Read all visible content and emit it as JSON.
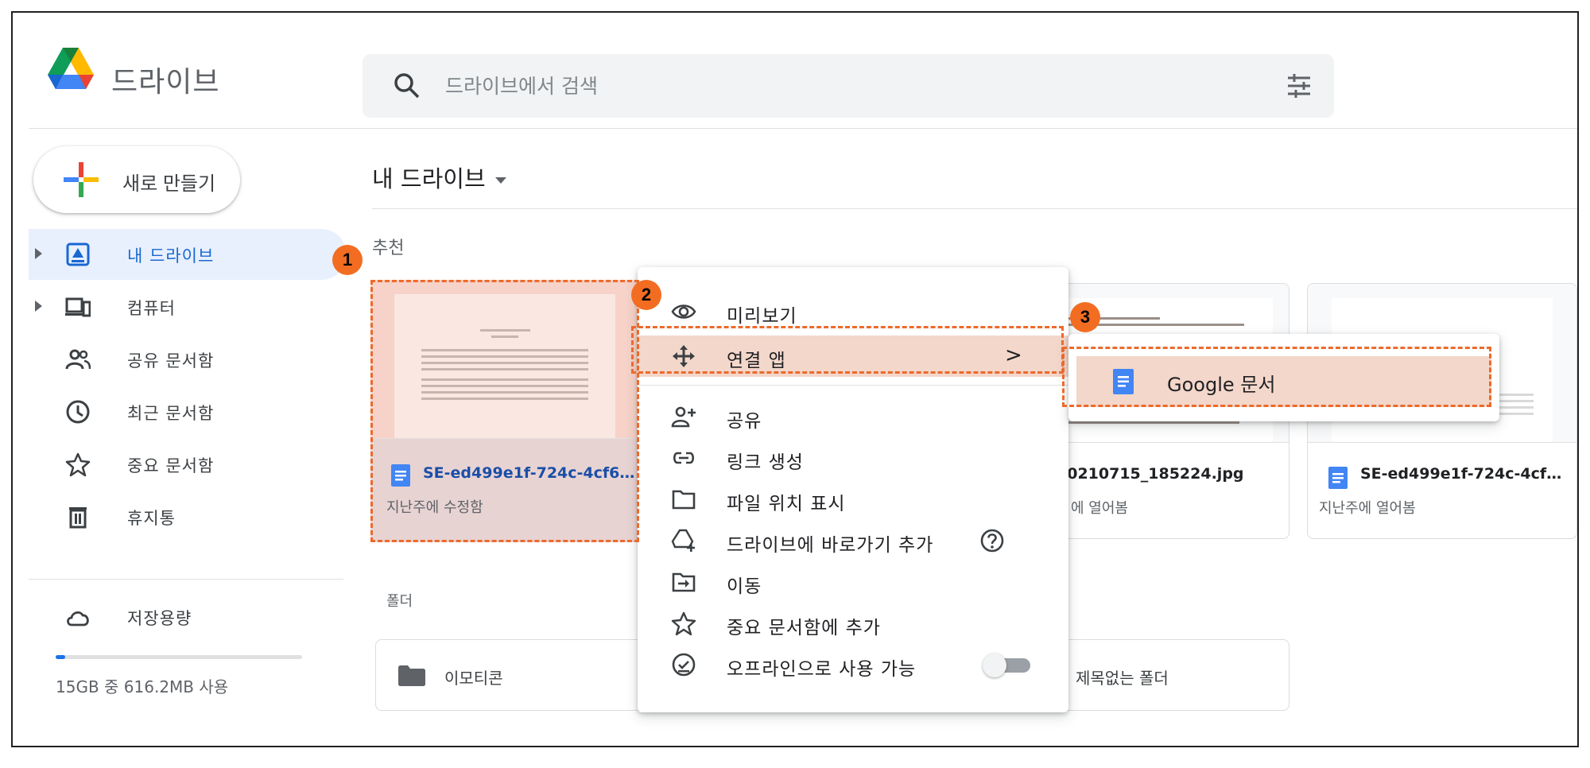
{
  "header": {
    "brand": "드라이브",
    "search_placeholder": "드라이브에서 검색"
  },
  "sidebar": {
    "new_button": "새로 만들기",
    "items": [
      {
        "label": "내 드라이브",
        "icon": "my-drive-icon",
        "active": true
      },
      {
        "label": "컴퓨터",
        "icon": "computers-icon"
      },
      {
        "label": "공유 문서함",
        "icon": "shared-icon"
      },
      {
        "label": "최근 문서함",
        "icon": "recent-clock-icon"
      },
      {
        "label": "중요 문서함",
        "icon": "star-icon"
      },
      {
        "label": "휴지통",
        "icon": "trash-icon"
      }
    ],
    "storage_label": "저장용량",
    "storage_text": "15GB 중 616.2MB 사용",
    "storage_used_fraction": 0.04
  },
  "main": {
    "title": "내 드라이브",
    "suggested_label": "추천",
    "folders_label": "폴더",
    "cards": [
      {
        "name": "SE-ed499e1f-724c-4cf6-...",
        "sub": "지난주에 수정함"
      },
      {
        "name": "20210715_185224.jpg",
        "sub": "에 열어봄"
      },
      {
        "name": "SE-ed499e1f-724c-4cf6-...",
        "sub": "지난주에 열어봄"
      }
    ],
    "folders": [
      {
        "name": "이모티콘"
      },
      {
        "name": "제목없는 폴더"
      }
    ]
  },
  "context_menu": {
    "items": [
      {
        "label": "미리보기",
        "icon": "eye-icon"
      },
      {
        "label": "연결 앱",
        "icon": "open-with-icon",
        "arrow": ">"
      },
      {
        "label": "공유",
        "icon": "person-add-icon"
      },
      {
        "label": "링크 생성",
        "icon": "link-icon"
      },
      {
        "label": "파일 위치 표시",
        "icon": "folder-outline-icon"
      },
      {
        "label": "드라이브에 바로가기 추가",
        "icon": "add-shortcut-icon"
      },
      {
        "label": "이동",
        "icon": "move-icon"
      },
      {
        "label": "중요 문서함에 추가",
        "icon": "star-outline-icon"
      },
      {
        "label": "오프라인으로 사용 가능",
        "icon": "offline-check-icon"
      }
    ],
    "offline_enabled": false
  },
  "submenu": {
    "items": [
      {
        "label": "Google 문서",
        "icon": "google-docs-icon"
      }
    ]
  },
  "annotations": [
    {
      "number": "1"
    },
    {
      "number": "2"
    },
    {
      "number": "3"
    }
  ],
  "colors": {
    "accent": "#1a73e8",
    "annotation": "#ec6a2b",
    "highlight": "#f3d7ca",
    "active_nav": "#e8f0fe"
  }
}
